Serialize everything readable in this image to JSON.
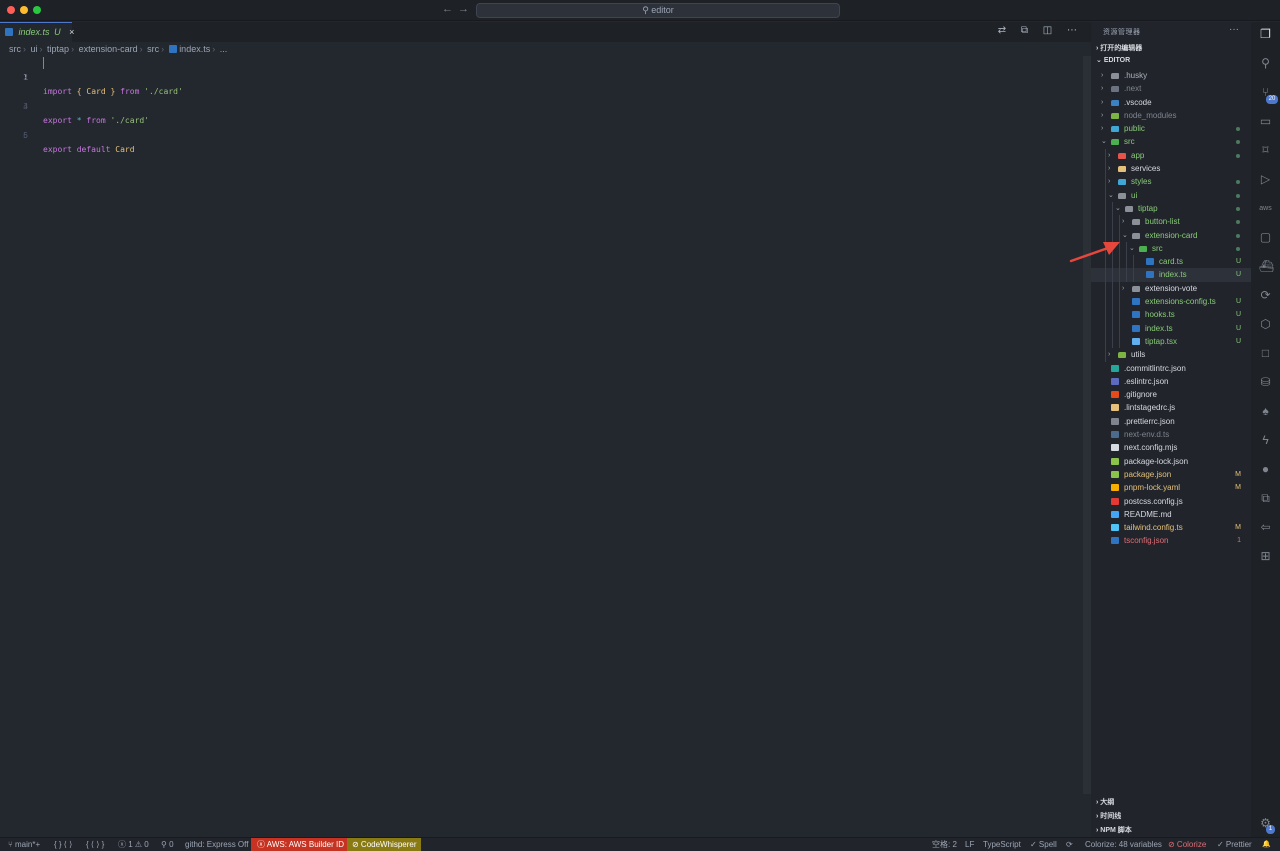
{
  "window": {
    "title": "editor",
    "back_arrow": "←",
    "forward_arrow": "→"
  },
  "tab": {
    "filename": "index.ts",
    "status": "U",
    "close": "×"
  },
  "tab_actions": "⇄ ⧉ ◫ ⋯",
  "breadcrumb": [
    "src",
    "ui",
    "tiptap",
    "extension-card",
    "src",
    "index.ts",
    "..."
  ],
  "code": [
    {
      "n": "1"
    },
    {
      "n": "2"
    },
    {
      "n": "3"
    },
    {
      "n": "4"
    },
    {
      "n": "5"
    },
    {
      "n": "6"
    }
  ],
  "code_tokens": {
    "l1": [
      "import",
      "{",
      "Card",
      "}",
      "from",
      "'./card'"
    ],
    "l3": [
      "export",
      "*",
      "from",
      "'./card'"
    ],
    "l5": [
      "export",
      "default",
      "Card"
    ]
  },
  "explorer": {
    "header": "资源管理器",
    "more": "···",
    "open_editors": "打开的编辑器",
    "root": "EDITOR",
    "outline": "大纲",
    "timeline": "时间线",
    "npm": "NPM 脚本"
  },
  "tree": [
    {
      "label": ".husky",
      "depth": 0,
      "type": "folder",
      "open": false,
      "color": "#abb2bf",
      "icon": "#8a8f98",
      "badge": ""
    },
    {
      "label": ".next",
      "depth": 0,
      "type": "folder",
      "open": false,
      "color": "#7f848e",
      "icon": "#6b7280",
      "badge": ""
    },
    {
      "label": ".vscode",
      "depth": 0,
      "type": "folder",
      "open": false,
      "color": "#d7dae0",
      "icon": "#3b82c4",
      "badge": ""
    },
    {
      "label": "node_modules",
      "depth": 0,
      "type": "folder",
      "open": false,
      "color": "#7f848e",
      "icon": "#7cb342",
      "badge": ""
    },
    {
      "label": "public",
      "depth": 0,
      "type": "folder",
      "open": false,
      "color": "#89ca78",
      "icon": "#3fa7d6",
      "badge": "dot"
    },
    {
      "label": "src",
      "depth": 0,
      "type": "folder",
      "open": true,
      "color": "#89ca78",
      "icon": "#4caf50",
      "badge": "dot"
    },
    {
      "label": "app",
      "depth": 1,
      "type": "folder",
      "open": false,
      "color": "#89ca78",
      "icon": "#e5534b",
      "badge": "dot"
    },
    {
      "label": "services",
      "depth": 1,
      "type": "folder",
      "open": false,
      "color": "#d7dae0",
      "icon": "#e5c07b",
      "badge": ""
    },
    {
      "label": "styles",
      "depth": 1,
      "type": "folder",
      "open": false,
      "color": "#89ca78",
      "icon": "#3fa7d6",
      "badge": "dot"
    },
    {
      "label": "ui",
      "depth": 1,
      "type": "folder",
      "open": true,
      "color": "#89ca78",
      "icon": "#8a8f98",
      "badge": "dot"
    },
    {
      "label": "tiptap",
      "depth": 2,
      "type": "folder",
      "open": true,
      "color": "#89ca78",
      "icon": "#8a8f98",
      "badge": "dot"
    },
    {
      "label": "button-list",
      "depth": 3,
      "type": "folder",
      "open": false,
      "color": "#89ca78",
      "icon": "#8a8f98",
      "badge": "dot"
    },
    {
      "label": "extension-card",
      "depth": 3,
      "type": "folder",
      "open": true,
      "color": "#89ca78",
      "icon": "#8a8f98",
      "badge": "dot"
    },
    {
      "label": "src",
      "depth": 4,
      "type": "folder",
      "open": true,
      "color": "#89ca78",
      "icon": "#4caf50",
      "badge": "dot"
    },
    {
      "label": "card.ts",
      "depth": 5,
      "type": "file",
      "color": "#89ca78",
      "icon": "#2f74c0",
      "badge": "U"
    },
    {
      "label": "index.ts",
      "depth": 5,
      "type": "file",
      "color": "#89ca78",
      "icon": "#2f74c0",
      "badge": "U",
      "selected": true
    },
    {
      "label": "extension-vote",
      "depth": 3,
      "type": "folder",
      "open": false,
      "color": "#d7dae0",
      "icon": "#8a8f98",
      "badge": ""
    },
    {
      "label": "extensions-config.ts",
      "depth": 3,
      "type": "file",
      "color": "#89ca78",
      "icon": "#2f74c0",
      "badge": "U"
    },
    {
      "label": "hooks.ts",
      "depth": 3,
      "type": "file",
      "color": "#89ca78",
      "icon": "#2f74c0",
      "badge": "U"
    },
    {
      "label": "index.ts",
      "depth": 3,
      "type": "file",
      "color": "#89ca78",
      "icon": "#2f74c0",
      "badge": "U"
    },
    {
      "label": "tiptap.tsx",
      "depth": 3,
      "type": "file",
      "color": "#89ca78",
      "icon": "#61afef",
      "badge": "U"
    },
    {
      "label": "utils",
      "depth": 1,
      "type": "folder",
      "open": false,
      "color": "#d7dae0",
      "icon": "#7cb342",
      "badge": ""
    },
    {
      "label": ".commitlintrc.json",
      "depth": 0,
      "type": "file",
      "color": "#d7dae0",
      "icon": "#26a69a",
      "badge": ""
    },
    {
      "label": ".eslintrc.json",
      "depth": 0,
      "type": "file",
      "color": "#d7dae0",
      "icon": "#5c6bc0",
      "badge": ""
    },
    {
      "label": ".gitignore",
      "depth": 0,
      "type": "file",
      "color": "#d7dae0",
      "icon": "#e64a19",
      "badge": ""
    },
    {
      "label": ".lintstagedrc.js",
      "depth": 0,
      "type": "file",
      "color": "#d7dae0",
      "icon": "#e5c07b",
      "badge": ""
    },
    {
      "label": ".prettierrc.json",
      "depth": 0,
      "type": "file",
      "color": "#d7dae0",
      "icon": "#7f848e",
      "badge": ""
    },
    {
      "label": "next-env.d.ts",
      "depth": 0,
      "type": "file",
      "color": "#7f848e",
      "icon": "#4b6a8c",
      "badge": ""
    },
    {
      "label": "next.config.mjs",
      "depth": 0,
      "type": "file",
      "color": "#d7dae0",
      "icon": "#d7dae0",
      "badge": ""
    },
    {
      "label": "package-lock.json",
      "depth": 0,
      "type": "file",
      "color": "#d7dae0",
      "icon": "#8bc34a",
      "badge": ""
    },
    {
      "label": "package.json",
      "depth": 0,
      "type": "file",
      "color": "#e5c07b",
      "icon": "#8bc34a",
      "badge": "M"
    },
    {
      "label": "pnpm-lock.yaml",
      "depth": 0,
      "type": "file",
      "color": "#e5c07b",
      "icon": "#f9ad00",
      "badge": "M"
    },
    {
      "label": "postcss.config.js",
      "depth": 0,
      "type": "file",
      "color": "#d7dae0",
      "icon": "#e53935",
      "badge": ""
    },
    {
      "label": "README.md",
      "depth": 0,
      "type": "file",
      "color": "#d7dae0",
      "icon": "#42a5f5",
      "badge": ""
    },
    {
      "label": "tailwind.config.ts",
      "depth": 0,
      "type": "file",
      "color": "#e5c07b",
      "icon": "#4fc3f7",
      "badge": "M"
    },
    {
      "label": "tsconfig.json",
      "depth": 0,
      "type": "file",
      "color": "#e06c75",
      "icon": "#2f74c0",
      "badge": "1"
    }
  ],
  "activity": {
    "scm_badge": "20",
    "settings_badge": "1"
  },
  "statusbar": {
    "branch": "⑂ main*+",
    "nav1": "{ } ⟨ ⟩",
    "nav2": "{ ⟨ ⟩ }",
    "problems": "ⓧ 1 ⚠ 0",
    "ports": "⚲ 0",
    "githd": "githd: Express Off",
    "aws": "ⓧ AWS: AWS Builder ID",
    "cw": "⊘ CodeWhisperer",
    "spaces": "空格: 2",
    "eol": "LF",
    "lang": "TypeScript",
    "spell": "✓ Spell",
    "colorize_vars": "Colorize: 48 variables",
    "colorize": "⊘ Colorize",
    "prettier": "✓ Prettier",
    "bell": "🔔"
  },
  "colors": {
    "accent": "#4d78cc",
    "aws_red": "#c63322",
    "cw_yellow": "#8a7a14",
    "arrow_red": "#e5473d"
  }
}
